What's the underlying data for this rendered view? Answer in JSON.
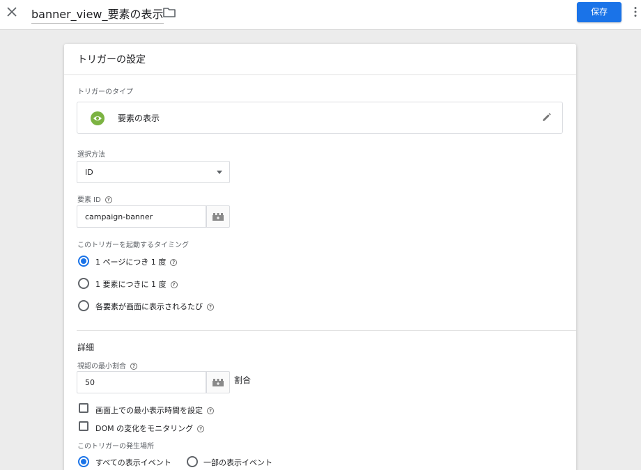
{
  "header": {
    "title": "banner_view_要素の表示",
    "save_label": "保存",
    "icons": [
      "close-icon",
      "folder-icon",
      "more-vert-icon"
    ],
    "accent_color": "#1a73e8"
  },
  "card": {
    "title": "トリガーの設定",
    "trigger_type_label": "トリガーのタイプ",
    "trigger_type_value": "要素の表示",
    "trigger_type_color": "#7cb342",
    "selection_method_label": "選択方法",
    "selection_method_value": "ID",
    "element_id_label": "要素 ID",
    "element_id_value": "campaign-banner",
    "timing_label": "このトリガーを起動するタイミング",
    "timing_options": [
      {
        "label": "1 ページにつき 1 度",
        "selected": true
      },
      {
        "label": "1 要素につきに 1 度",
        "selected": false
      },
      {
        "label": "各要素が画面に表示されるたび",
        "selected": false
      }
    ],
    "details_title": "詳細",
    "min_ratio_label": "視認の最小割合",
    "min_ratio_value": "50",
    "min_ratio_unit": "割合",
    "checkboxes": [
      {
        "label": "画面上での最小表示時間を設定",
        "checked": false
      },
      {
        "label": "DOM の変化をモニタリング",
        "checked": false
      }
    ],
    "fire_on_label": "このトリガーの発生場所",
    "fire_on_options": [
      {
        "label": "すべての表示イベント",
        "selected": true
      },
      {
        "label": "一部の表示イベント",
        "selected": false
      }
    ]
  }
}
